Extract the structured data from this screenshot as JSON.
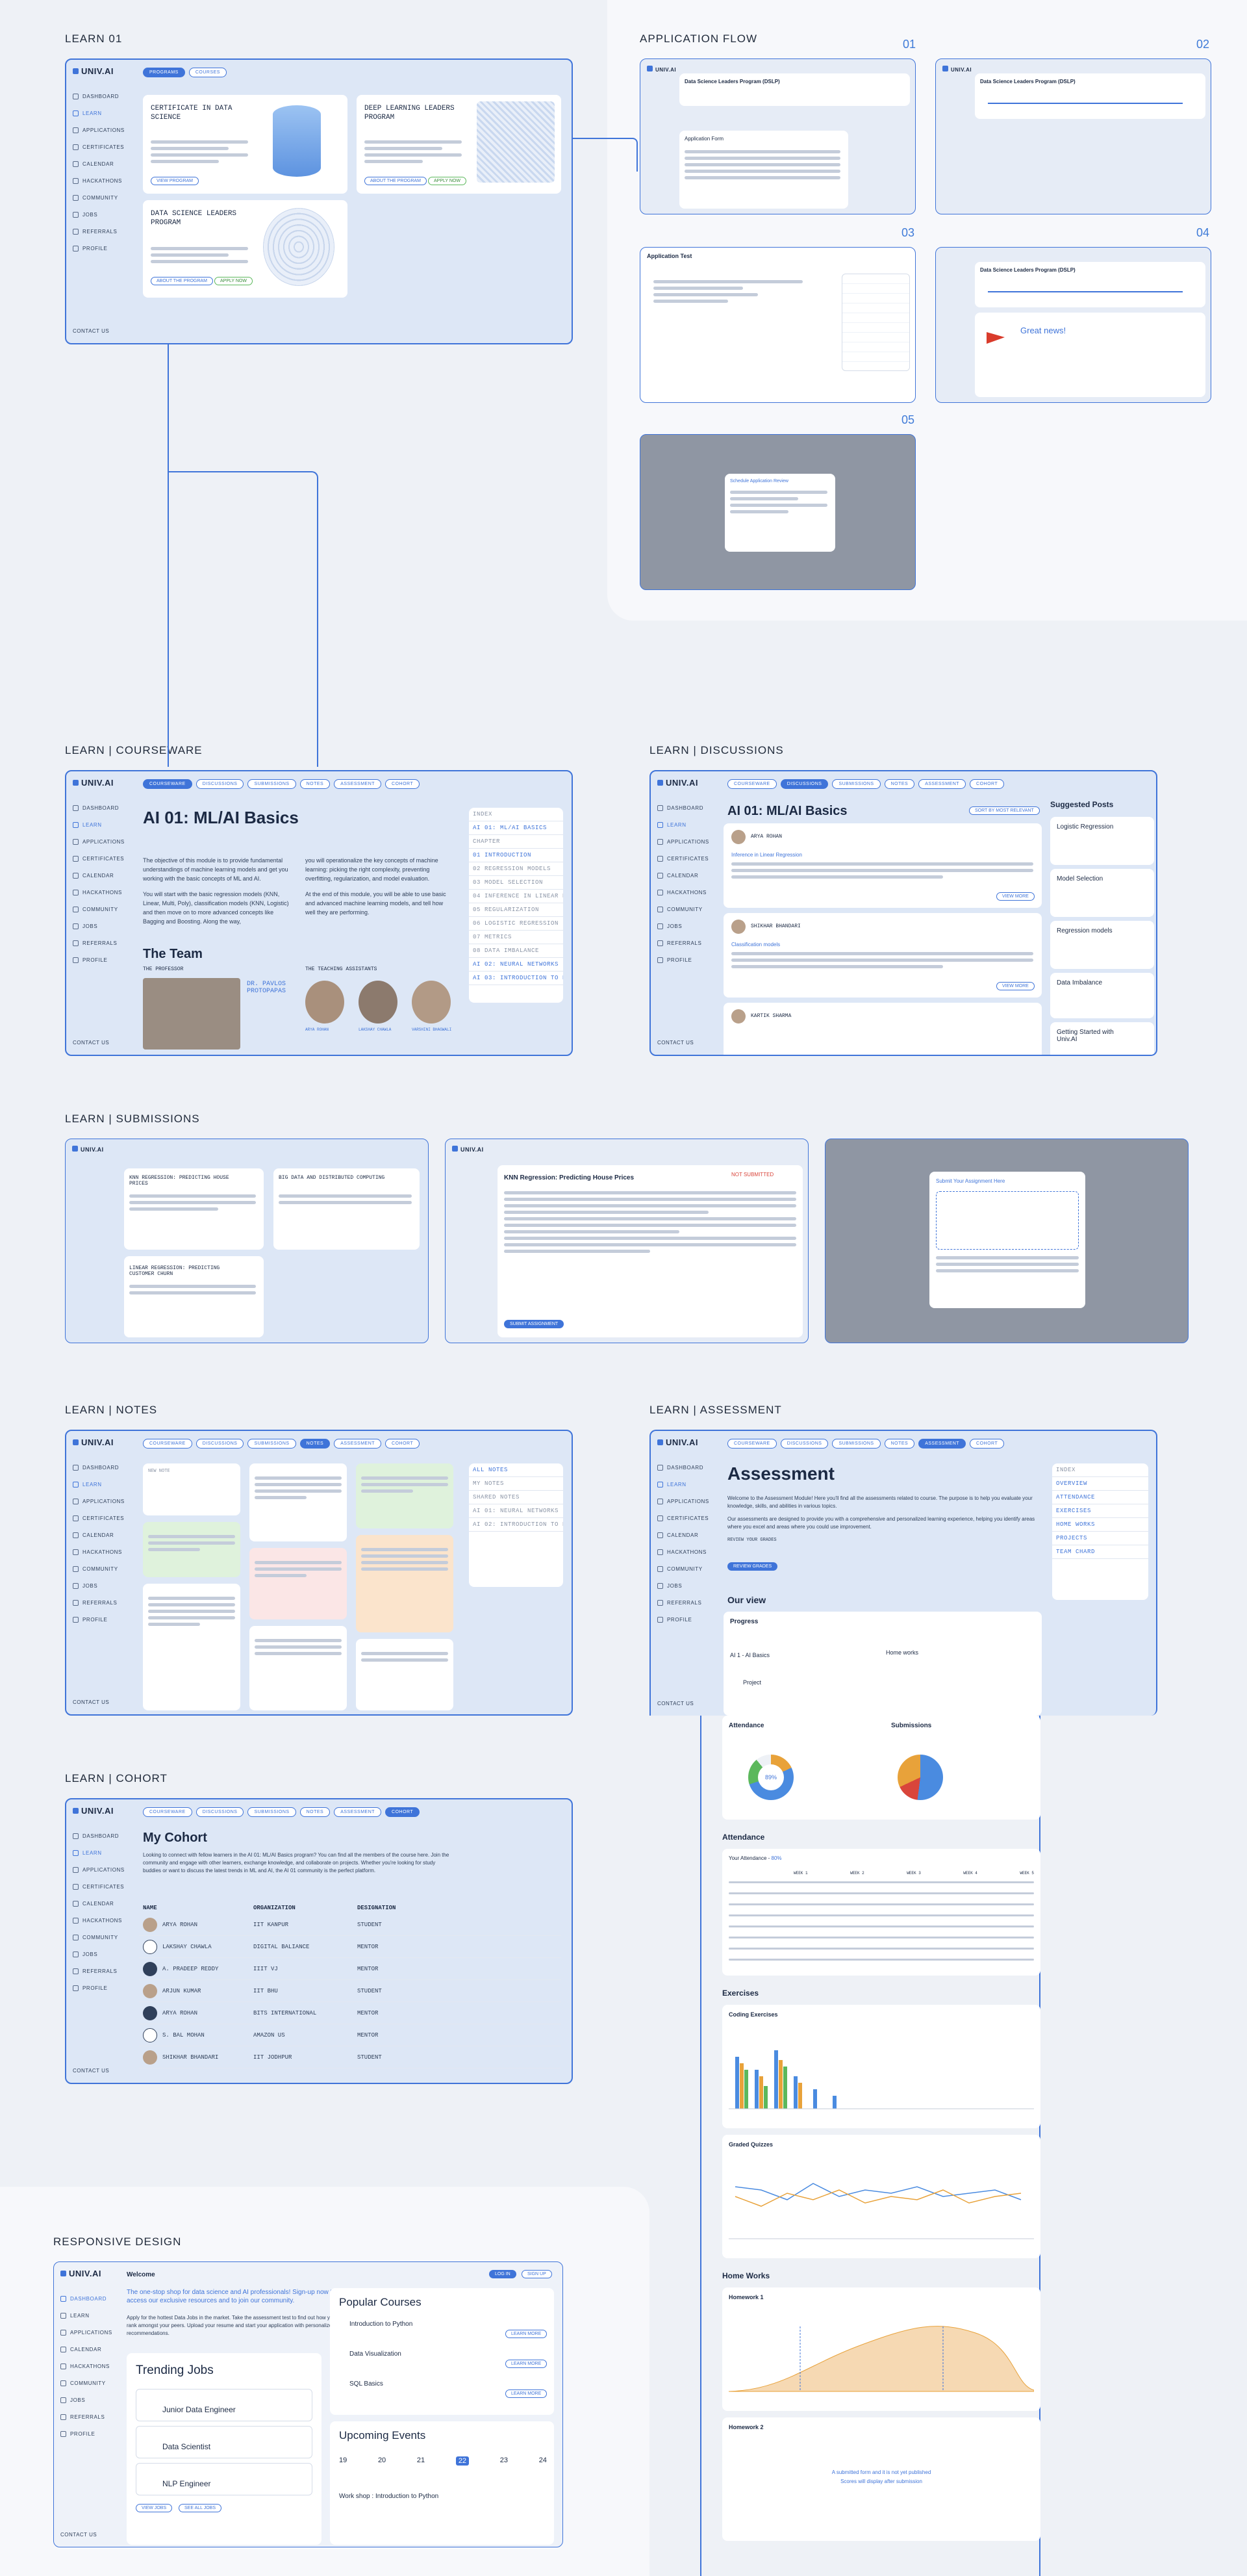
{
  "brand": "UNIV.AI",
  "sidebar_items": [
    "DASHBOARD",
    "LEARN",
    "APPLICATIONS",
    "CERTIFICATES",
    "CALENDAR",
    "HACKATHONS",
    "COMMUNITY",
    "JOBS",
    "REFERRALS",
    "PROFILE"
  ],
  "contact": "CONTACT US",
  "sections": {
    "learn01": "LEARN 01",
    "flow": "APPLICATION FLOW",
    "courseware": "LEARN | COURSEWARE",
    "discussions": "LEARN | DISCUSSIONS",
    "submissions": "LEARN | SUBMISSIONS",
    "notes": "LEARN | NOTES",
    "assessment": "LEARN | ASSESSMENT",
    "cohort": "LEARN | COHORT",
    "responsive": "RESPONSIVE DESIGN"
  },
  "flow_steps": [
    "01",
    "02",
    "03",
    "04",
    "05"
  ],
  "learn01": {
    "tabs": [
      "PROGRAMS",
      "COURSES"
    ],
    "cards": [
      {
        "title": "CERTIFICATE IN DATA SCIENCE",
        "button": "VIEW PROGRAM"
      },
      {
        "title": "DEEP LEARNING LEADERS PROGRAM",
        "button": "ABOUT THE PROGRAM",
        "button2": "APPLY NOW"
      },
      {
        "title": "DATA SCIENCE LEADERS PROGRAM",
        "button": "ABOUT THE PROGRAM",
        "button2": "APPLY NOW"
      }
    ]
  },
  "flow": {
    "program": "Data Science Leaders Program (DSLP)",
    "form_title": "Application Form",
    "test_title": "Application Test",
    "great": "Great news!",
    "modal_title": "Schedule Application Review"
  },
  "course_tabs": [
    "COURSEWARE",
    "DISCUSSIONS",
    "SUBMISSIONS",
    "NOTES",
    "ASSESSMENT",
    "COHORT"
  ],
  "courseware": {
    "title": "AI 01: ML/AI Basics",
    "intro_left": "The objective of this module is to provide fundamental understandings of machine learning models and get you working with the basic concepts of ML and AI.",
    "intro_left2": "You will start with the basic regression models (KNN, Linear, Multi, Poly), classification models (KNN, Logistic) and then move on to more advanced concepts like Bagging and Boosting. Along the way,",
    "intro_right": "you will operationalize the key concepts of machine learning: picking the right complexity, preventing overfitting, regularization, and model evaluation.",
    "intro_right2": "At the end of this module, you will be able to use basic and advanced machine learning models, and tell how well they are performing.",
    "team": "The Team",
    "professor_label": "THE PROFESSOR",
    "professor_name": "DR. PAVLOS PROTOPAPAS",
    "ta_label": "THE TEACHING ASSISTANTS",
    "tas": [
      "ARYA ROHAN",
      "LAKSHAY CHAWLA",
      "VARSHINI BHAGWALI"
    ],
    "toc_head": "INDEX",
    "toc": [
      "AI 01: ML/AI BASICS",
      "CHAPTER",
      "01 INTRODUCTION",
      "02 REGRESSION MODELS",
      "03 MODEL SELECTION",
      "04 INFERENCE IN LINEAR REGRESSION",
      "05 REGULARIZATION",
      "06 LOGISTIC REGRESSION",
      "07 METRICS",
      "08 DATA IMBALANCE",
      "AI 02: NEURAL NETWORKS",
      "AI 03: INTRODUCTION TO DATA SCIENCE"
    ]
  },
  "discussions": {
    "title": "AI 01: ML/AI Basics",
    "sort": "SORT BY MOST RELEVANT",
    "posts": [
      {
        "author": "ARYA ROHAN",
        "title": "Inference in Linear Regression",
        "button": "VIEW MORE"
      },
      {
        "author": "SHIKHAR BHANDARI",
        "title": "Classification models",
        "button": "VIEW MORE"
      },
      {
        "author": "KARTIK SHARMA",
        "title": "",
        "button": ""
      }
    ],
    "suggested": "Suggested Posts",
    "suggested_items": [
      "Logistic Regression",
      "Model Selection",
      "Regression models",
      "Data Imbalance",
      "Getting Started with Univ.AI"
    ]
  },
  "submissions": {
    "items": [
      "KNN REGRESSION: PREDICTING HOUSE PRICES",
      "BIG DATA AND DISTRIBUTED COMPUTING",
      "LINEAR REGRESSION: PREDICTING CUSTOMER CHURN"
    ],
    "detail_title": "KNN Regression: Predicting House Prices",
    "status": "NOT SUBMITTED",
    "modal": "Submit Your Assignment Here",
    "submit": "SUBMIT ASSIGNMENT"
  },
  "notes": {
    "new_note": "NEW NOTE",
    "toc": [
      "ALL NOTES",
      "MY NOTES",
      "SHARED NOTES",
      "AI 01: NEURAL NETWORKS",
      "AI 02: INTRODUCTION TO DATA SCIENCE"
    ]
  },
  "assessment": {
    "title": "Assessment",
    "intro": "Welcome to the Assessment Module! Here you’ll find all the assessments related to course. The purpose is to help you evaluate your knowledge, skills, and abilities in various topics.",
    "intro2": "Our assessments are designed to provide you with a comprehensive and personalized learning experience, helping you identify areas where you excel and areas where you could use improvement.",
    "cta_label": "REVIEW YOUR GRADES",
    "cta": "REVIEW GRADES",
    "overview": "Our view",
    "progress": "Progress",
    "course": "AI 1 - AI Basics",
    "homeworks": "Home works",
    "project": "Project",
    "attendance": "Attendance",
    "submissions": "Submissions",
    "pie1": "89%",
    "sections": [
      "Attendance",
      "Exercises",
      "Home Works"
    ],
    "your_attendance": "Your Attendance",
    "attendance_pct": "80%",
    "weeks": [
      "WEEK 1",
      "WEEK 2",
      "WEEK 3",
      "WEEK 4",
      "WEEK 5"
    ],
    "coding": "Coding Exercises",
    "quizzes": "Graded Quizzes",
    "hw1": "Homework 1",
    "hw2": "Homework 2",
    "hw2_msg": "A submitted form and it is not yet published",
    "hw2_msg2": "Scores will display after submission",
    "toc": [
      "OVERVIEW",
      "ATTENDANCE",
      "EXERCISES",
      "HOME WORKS",
      "PROJECTS",
      "TEAM CHARD"
    ]
  },
  "cohort": {
    "title": "My Cohort",
    "intro": "Looking to connect with fellow learners in the AI 01: ML/AI Basics program? You can find all the members of the course here. Join the community and engage with other learners, exchange knowledge, and collaborate on projects. Whether you're looking for study buddies or want to discuss the latest trends in ML and AI, the AI 01 community is the perfect platform.",
    "columns": [
      "NAME",
      "ORGANIZATION",
      "DESIGNATION"
    ],
    "members": [
      {
        "name": "ARYA ROHAN",
        "org": "IIT KANPUR",
        "role": "STUDENT"
      },
      {
        "name": "LAKSHAY CHAWLA",
        "org": "DIGITAL BALIANCE",
        "role": "MENTOR"
      },
      {
        "name": "A. PRADEEP REDDY",
        "org": "IIIT VJ",
        "role": "MENTOR"
      },
      {
        "name": "ARJUN KUMAR",
        "org": "IIT BHU",
        "role": "STUDENT"
      },
      {
        "name": "ARYA ROHAN",
        "org": "BITS INTERNATIONAL",
        "role": "MENTOR"
      },
      {
        "name": "S. BAL MOHAN",
        "org": "AMAZON US",
        "role": "MENTOR"
      },
      {
        "name": "SHIKHAR BHANDARI",
        "org": "IIT JODHPUR",
        "role": "STUDENT"
      }
    ]
  },
  "responsive": {
    "welcome": "Welcome",
    "tagline": "The one-stop shop for data science and AI professionals! Sign-up now to access our exclusive resources and to join our community.",
    "sub": "Apply for the hottest Data Jobs in the market. Take the assessment test to find out how your rank amongst your peers. Upload your resume and start your application with personalized AI recommendations.",
    "jobs_title": "Trending Jobs",
    "jobs": [
      "Junior Data Engineer",
      "Data Scientist",
      "NLP Engineer"
    ],
    "jobs_buttons": [
      "VIEW JOBS",
      "SEE ALL JOBS"
    ],
    "courses_title": "Popular Courses",
    "courses": [
      "Introduction to Python",
      "Data Visualization",
      "SQL Basics"
    ],
    "course_button": "LEARN MORE",
    "events_title": "Upcoming Events",
    "days": [
      "19",
      "20",
      "21",
      "22",
      "23",
      "24"
    ],
    "event": "Work shop : Introduction to Python",
    "header_pills": [
      "LOG IN",
      "SIGN UP"
    ]
  },
  "colors": {
    "accent": "#3f74d9",
    "bg": "#eef1f6",
    "frame": "#dde7f6"
  }
}
